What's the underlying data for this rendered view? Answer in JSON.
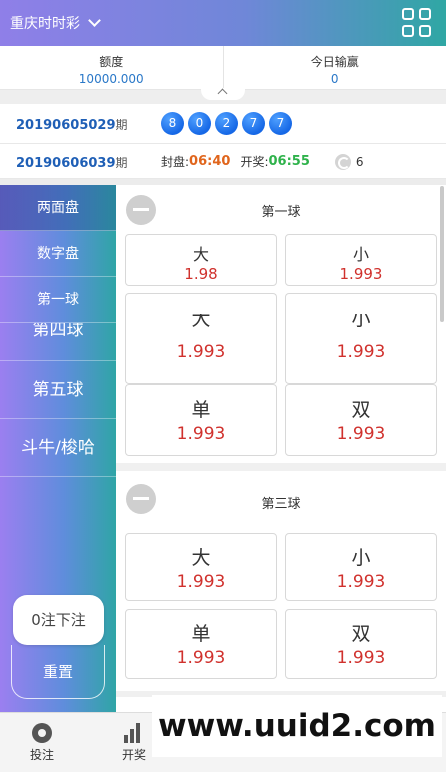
{
  "header": {
    "title": "重庆时时彩"
  },
  "balance": {
    "credit_label": "额度",
    "credit_value": "10000.000",
    "today_label": "今日输赢",
    "today_value": "0"
  },
  "last_draw": {
    "period": "20190605029",
    "suffix": "期",
    "balls": [
      "8",
      "0",
      "2",
      "7",
      "7"
    ]
  },
  "next_draw": {
    "period": "20190606039",
    "suffix": "期",
    "close_label": "封盘:",
    "close_time": "06:40",
    "open_label": "开奖:",
    "open_time": "06:55",
    "count": "6"
  },
  "sidebar": {
    "items": [
      {
        "label": "两面盘"
      },
      {
        "label": "数字盘"
      },
      {
        "label": "第一球"
      },
      {
        "label": "第四球"
      },
      {
        "label": "第五球"
      },
      {
        "label": "斗牛/梭哈"
      }
    ],
    "bet_label": "0注下注",
    "reset_label": "重置"
  },
  "sections": [
    {
      "title": "第一球",
      "options": [
        {
          "label": "大",
          "odds": "1.98"
        },
        {
          "label": "小",
          "odds": "1.993"
        }
      ]
    },
    {
      "overlay_options": [
        {
          "label": "大",
          "odds": "1.993"
        },
        {
          "label": "小",
          "odds": "1.993"
        },
        {
          "label": "单",
          "odds": "1.993"
        },
        {
          "label": "双",
          "odds": "1.993"
        }
      ]
    },
    {
      "title": "第三球",
      "options": [
        {
          "label": "大",
          "odds": "1.993"
        },
        {
          "label": "小",
          "odds": "1.993"
        },
        {
          "label": "单",
          "odds": "1.993"
        },
        {
          "label": "双",
          "odds": "1.993"
        }
      ]
    }
  ],
  "bottom_nav": [
    {
      "label": "投注",
      "icon": "ball-icon"
    },
    {
      "label": "开奖",
      "icon": "chart-icon"
    }
  ],
  "watermark": "www.uuid2.com",
  "colors": {
    "odds": "#d0312d",
    "period": "#1f5fb6",
    "close_time": "#e0651c",
    "open_time": "#2fb24b",
    "ball": "#1668e6"
  }
}
